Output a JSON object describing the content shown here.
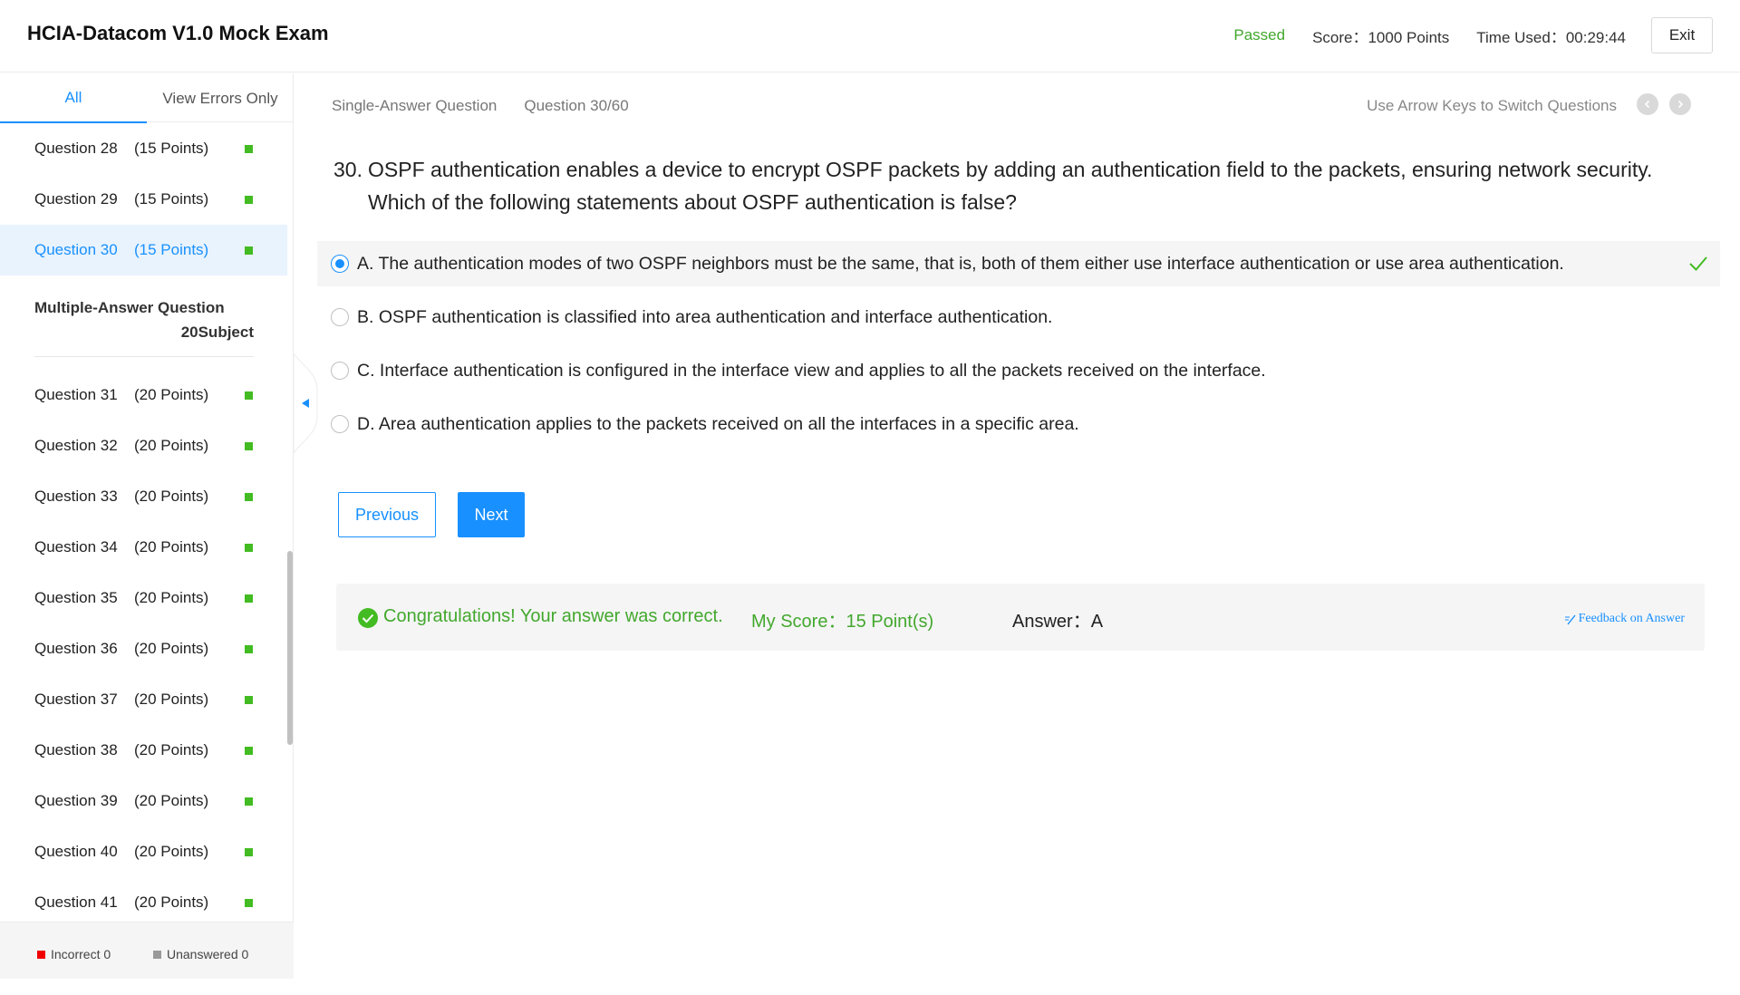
{
  "header": {
    "title": "HCIA-Datacom V1.0 Mock Exam",
    "status": "Passed",
    "score": "Score：1000 Points",
    "time_used": "Time Used：00:29:44",
    "exit_label": "Exit"
  },
  "sidebar": {
    "tabs": [
      "All",
      "View Errors Only"
    ],
    "active_tab": "All",
    "single_items": [
      {
        "name": "Question 28",
        "points": "(15 Points)"
      },
      {
        "name": "Question 29",
        "points": "(15 Points)"
      },
      {
        "name": "Question 30",
        "points": "(15 Points)",
        "active": true
      }
    ],
    "section": {
      "title": "Multiple-Answer Question",
      "subtitle": "20Subject"
    },
    "multi_items": [
      {
        "name": "Question 31",
        "points": "(20 Points)"
      },
      {
        "name": "Question 32",
        "points": "(20 Points)"
      },
      {
        "name": "Question 33",
        "points": "(20 Points)"
      },
      {
        "name": "Question 34",
        "points": "(20 Points)"
      },
      {
        "name": "Question 35",
        "points": "(20 Points)"
      },
      {
        "name": "Question 36",
        "points": "(20 Points)"
      },
      {
        "name": "Question 37",
        "points": "(20 Points)"
      },
      {
        "name": "Question 38",
        "points": "(20 Points)"
      },
      {
        "name": "Question 39",
        "points": "(20 Points)"
      },
      {
        "name": "Question 40",
        "points": "(20 Points)"
      },
      {
        "name": "Question 41",
        "points": "(20 Points)"
      }
    ],
    "footer": {
      "incorrect": "Incorrect 0",
      "unanswered": "Unanswered 0"
    }
  },
  "main": {
    "question_type": "Single-Answer Question",
    "question_counter": "Question 30/60",
    "arrow_hint": "Use Arrow Keys to Switch Questions",
    "question_number": "30.",
    "question_text": "OSPF authentication enables a device to encrypt OSPF packets by adding an authentication field to the packets, ensuring network security. Which of the following statements about OSPF authentication is false?",
    "options": [
      {
        "text": "A. The authentication modes of two OSPF neighbors must be the same, that is, both of them either use interface authentication or use area authentication.",
        "selected": true,
        "correct": true
      },
      {
        "text": "B. OSPF authentication is classified into area authentication and interface authentication.",
        "selected": false
      },
      {
        "text": "C. Interface authentication is configured in the interface view and applies to all the packets received on the interface.",
        "selected": false
      },
      {
        "text": "D. Area authentication applies to the packets received on all the interfaces in a specific area.",
        "selected": false
      }
    ],
    "prev_label": "Previous",
    "next_label": "Next",
    "result": {
      "message": "Congratulations! Your answer was correct.",
      "my_score": "My Score：15 Point(s)",
      "answer": "Answer：A",
      "feedback": "Feedback on Answer"
    }
  },
  "colors": {
    "accent": "#1890ff",
    "success": "#43a82e",
    "marker_green": "#43bb22",
    "incorrect_red": "#f00000",
    "unanswered_gray": "#999999"
  },
  "icons": [
    "collapse-arrow-icon",
    "prev-arrow-icon",
    "next-arrow-icon",
    "check-icon",
    "success-circle-icon",
    "edit-icon"
  ]
}
